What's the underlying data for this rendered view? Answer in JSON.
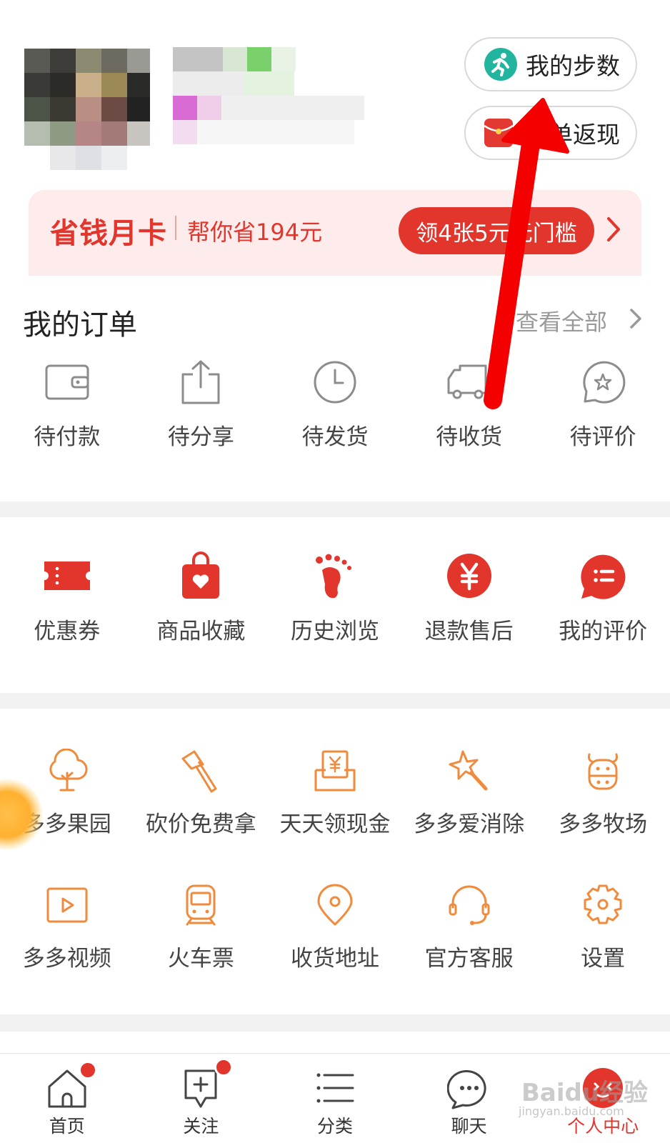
{
  "header": {
    "steps_button": "我的步数",
    "rebate_button": "晒单返现"
  },
  "savings_card": {
    "title": "省钱月卡",
    "subtitle": "帮你省194元",
    "cta": "领4张5元无门槛"
  },
  "orders": {
    "title": "我的订单",
    "view_all": "查看全部",
    "items": [
      {
        "label": "待付款",
        "icon": "wallet-icon"
      },
      {
        "label": "待分享",
        "icon": "share-icon"
      },
      {
        "label": "待发货",
        "icon": "clock-icon"
      },
      {
        "label": "待收货",
        "icon": "truck-icon"
      },
      {
        "label": "待评价",
        "icon": "star-bubble-icon"
      }
    ]
  },
  "services": {
    "items": [
      {
        "label": "优惠券",
        "icon": "coupon-icon"
      },
      {
        "label": "商品收藏",
        "icon": "heart-bag-icon"
      },
      {
        "label": "历史浏览",
        "icon": "footprint-icon"
      },
      {
        "label": "退款售后",
        "icon": "yuan-icon"
      },
      {
        "label": "我的评价",
        "icon": "comment-icon"
      }
    ]
  },
  "features": {
    "row1": [
      {
        "label": "多多果园",
        "icon": "tree-icon"
      },
      {
        "label": "砍价免费拿",
        "icon": "axe-icon"
      },
      {
        "label": "天天领现金",
        "icon": "cash-envelope-icon"
      },
      {
        "label": "多多爱消除",
        "icon": "magic-wand-icon"
      },
      {
        "label": "多多牧场",
        "icon": "cow-icon"
      }
    ],
    "row2": [
      {
        "label": "多多视频",
        "icon": "video-icon"
      },
      {
        "label": "火车票",
        "icon": "train-icon"
      },
      {
        "label": "收货地址",
        "icon": "location-icon"
      },
      {
        "label": "官方客服",
        "icon": "headset-icon"
      },
      {
        "label": "设置",
        "icon": "gear-icon"
      }
    ]
  },
  "bottom_nav": [
    {
      "label": "首页",
      "icon": "home-icon",
      "badge": true
    },
    {
      "label": "关注",
      "icon": "follow-icon",
      "badge": true
    },
    {
      "label": "分类",
      "icon": "category-icon",
      "badge": false
    },
    {
      "label": "聊天",
      "icon": "chat-icon",
      "badge": false
    },
    {
      "label": "个人中心",
      "icon": "profile-icon",
      "badge": false,
      "active": true
    }
  ],
  "watermark": {
    "text": "Baidu经验",
    "sub": "jingyan.baidu.com"
  },
  "colors": {
    "accent": "#e2352c",
    "orange": "#f08a3c",
    "steps_green": "#21b5a0",
    "card_bg": "#fdeceb"
  }
}
